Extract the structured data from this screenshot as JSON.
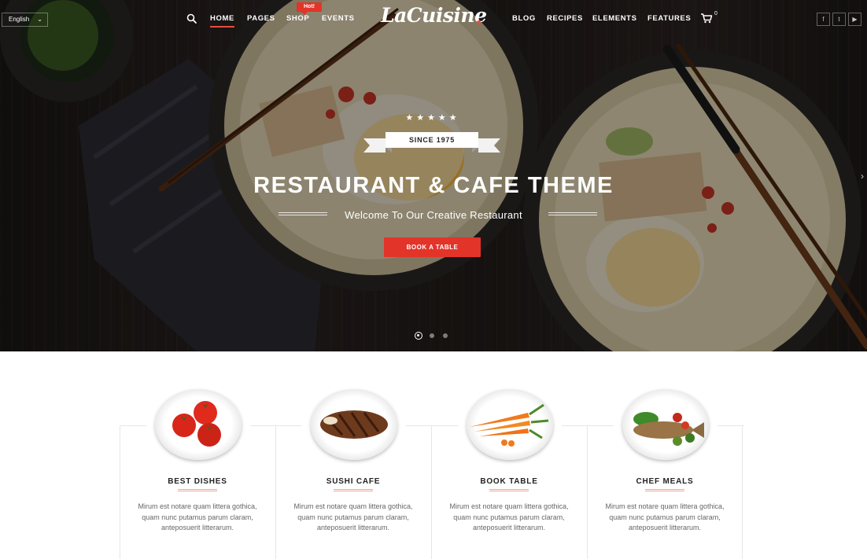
{
  "header": {
    "language": "English",
    "nav_left": [
      "HOME",
      "PAGES",
      "SHOP",
      "EVENTS"
    ],
    "hot_badge": "Hot!",
    "logo": "LaCuisine",
    "nav_right": [
      "BLOG",
      "RECIPES",
      "ELEMENTS",
      "FEATURES"
    ],
    "cart_count": "0",
    "social_icons": [
      "facebook-icon",
      "twitter-icon",
      "youtube-icon"
    ]
  },
  "hero": {
    "stars": "★★★★★",
    "since": "SINCE 1975",
    "title": "RESTAURANT & CAFE THEME",
    "subtitle": "Welcome To Our Creative Restaurant",
    "button": "BOOK A TABLE",
    "slide_count": 3,
    "active_slide": 1
  },
  "features": [
    {
      "title": "BEST DISHES",
      "text": "Mirum est notare quam littera gothica, quam nunc putamus parum claram, anteposuerit litterarum."
    },
    {
      "title": "SUSHI CAFE",
      "text": "Mirum est notare quam littera gothica, quam nunc putamus parum claram, anteposuerit litterarum."
    },
    {
      "title": "BOOK TABLE",
      "text": "Mirum est notare quam littera gothica, quam nunc putamus parum claram, anteposuerit litterarum."
    },
    {
      "title": "CHEF MEALS",
      "text": "Mirum est notare quam littera gothica, quam nunc putamus parum claram, anteposuerit litterarum."
    }
  ],
  "colors": {
    "accent": "#e3342a",
    "hero_dark": "#221c1a"
  }
}
